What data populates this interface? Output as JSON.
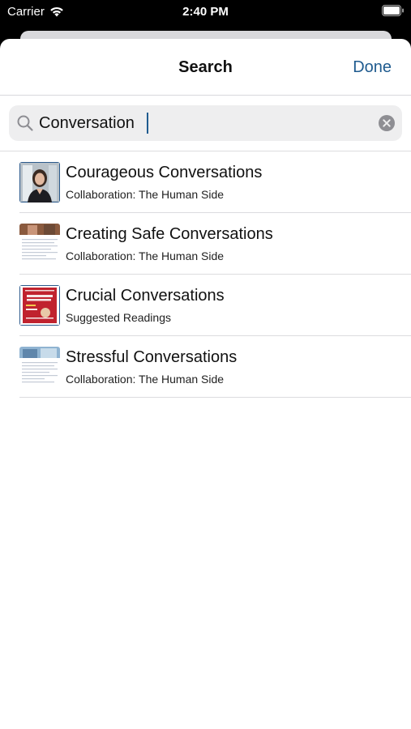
{
  "status_bar": {
    "carrier": "Carrier",
    "time": "2:40 PM"
  },
  "nav": {
    "title": "Search",
    "done_label": "Done"
  },
  "search": {
    "value": "Conversation"
  },
  "results": [
    {
      "title": "Courageous Conversations",
      "subtitle": "Collaboration: The Human Side",
      "thumbnail": "portrait-photo"
    },
    {
      "title": "Creating Safe Conversations",
      "subtitle": "Collaboration: The Human Side",
      "thumbnail": "article-page"
    },
    {
      "title": "Crucial Conversations",
      "subtitle": "Suggested Readings",
      "thumbnail": "book-cover"
    },
    {
      "title": "Stressful Conversations",
      "subtitle": "Collaboration: The Human Side",
      "thumbnail": "article-page"
    }
  ],
  "colors": {
    "accent": "#1f5b8f",
    "search_bg": "#eeeeef",
    "separator": "#dcdcdf"
  }
}
